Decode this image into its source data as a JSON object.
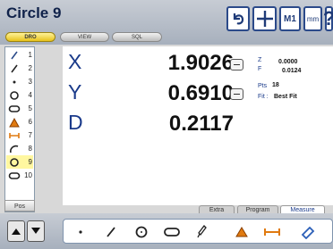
{
  "header": {
    "title": "Circle 9",
    "tabs": [
      "DRO",
      "VIEW",
      "SQL"
    ],
    "buttons": {
      "m1": "M1",
      "mm": "mm",
      "help": "?"
    }
  },
  "features": [
    {
      "icon": "line-icon",
      "num": "1"
    },
    {
      "icon": "line-icon",
      "num": "2"
    },
    {
      "icon": "point-icon",
      "num": "3"
    },
    {
      "icon": "circle-icon",
      "num": "4"
    },
    {
      "icon": "slot-icon",
      "num": "5"
    },
    {
      "icon": "angle-icon",
      "num": "6"
    },
    {
      "icon": "distance-icon",
      "num": "7"
    },
    {
      "icon": "arc-icon",
      "num": "8"
    },
    {
      "icon": "circle-icon",
      "num": "9",
      "selected": true
    },
    {
      "icon": "slot-icon",
      "num": "10"
    }
  ],
  "pos_label": "Pos",
  "measurements": [
    {
      "axis": "X",
      "value": "1.9026"
    },
    {
      "axis": "Y",
      "value": "0.6910"
    },
    {
      "axis": "D",
      "value": "0.2117"
    }
  ],
  "info": {
    "z_label": "Z",
    "z_value": "0.0000",
    "f_label": "F",
    "f_value": "0.0124",
    "pts_label": "Pts",
    "pts_value": "18",
    "fit_label": "Fit :",
    "fit_value": "Best Fit"
  },
  "bottom_tabs": [
    "Extra",
    "Program",
    "Measure"
  ],
  "toolbar_tools": [
    "point-tool-icon",
    "line-tool-icon",
    "circle-tool-icon",
    "slot-tool-icon",
    "probe-tool-icon",
    "angle-tool-icon",
    "distance-tool-icon",
    "eraser-tool-icon"
  ],
  "colors": {
    "accent": "#2b4a8a",
    "selected": "#fff7a0",
    "active_tab": "#e7c21a"
  }
}
